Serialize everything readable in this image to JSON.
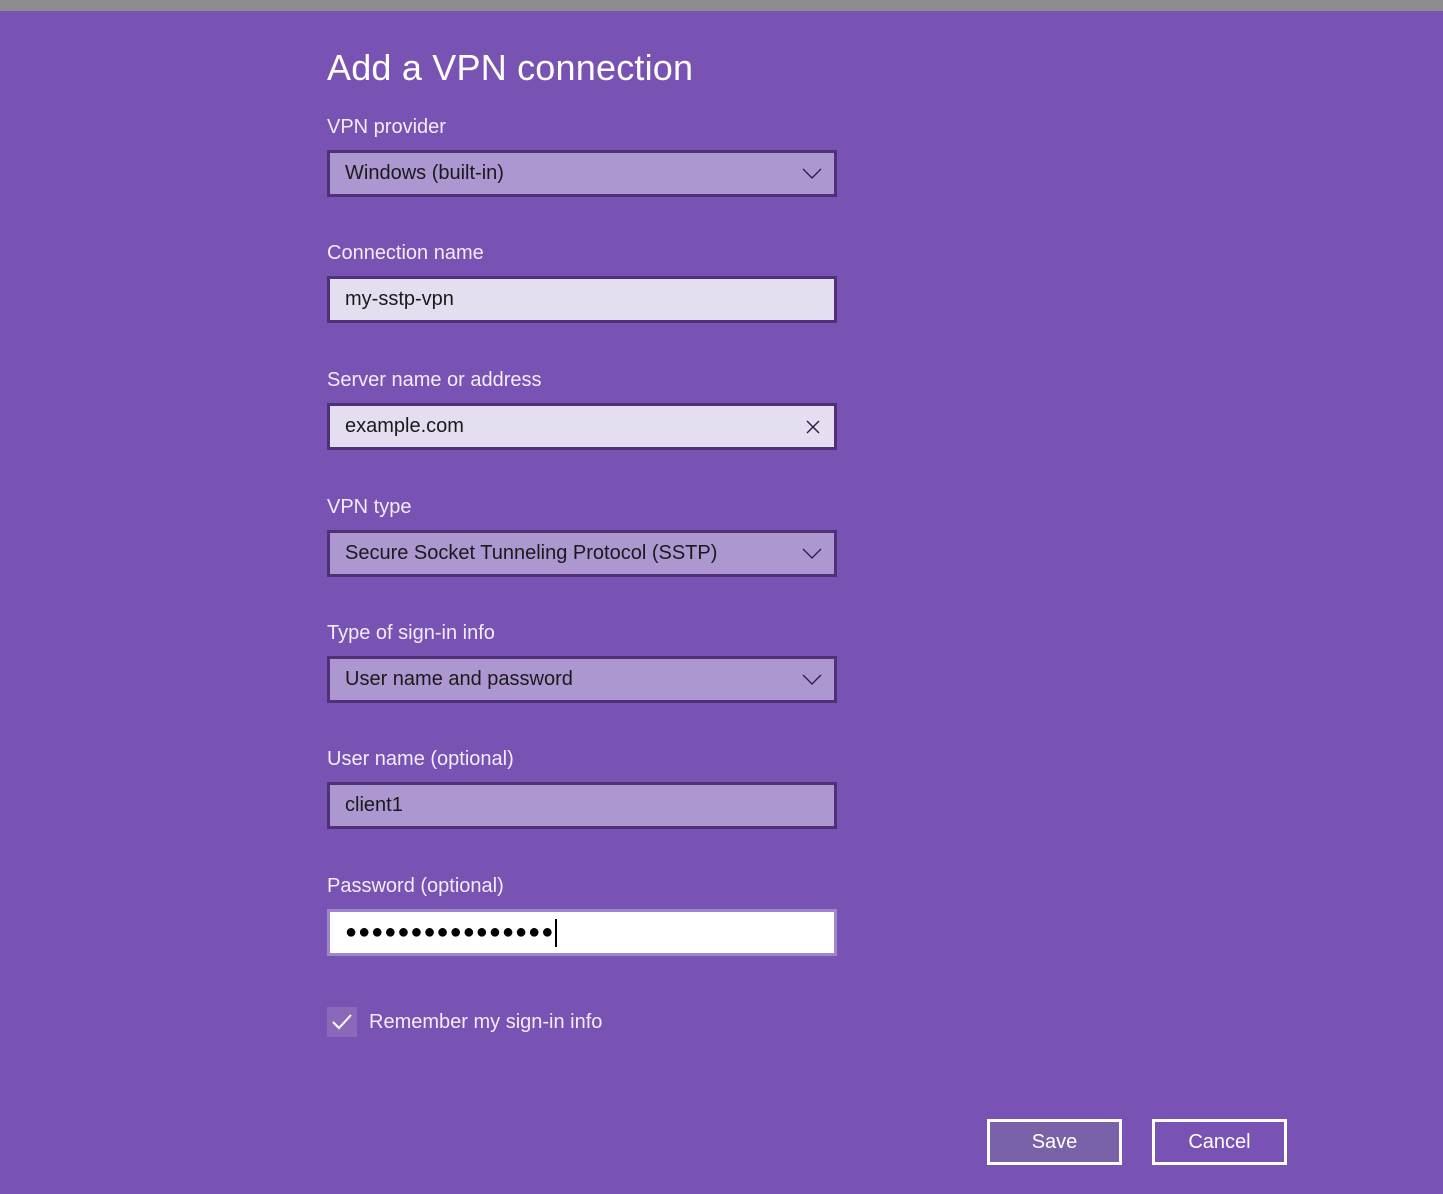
{
  "colors": {
    "background": "#7953b3",
    "top_bar": "#8c8c8c",
    "select_fill": "#ac97d1",
    "textbox_fill": "#e5ddf0",
    "control_border": "#4f3178"
  },
  "dialog": {
    "title": "Add a VPN connection",
    "fields": {
      "vpn_provider": {
        "label": "VPN provider",
        "value": "Windows (built-in)",
        "icon": "chevron-down-icon"
      },
      "connection_name": {
        "label": "Connection name",
        "value": "my-sstp-vpn"
      },
      "server_name": {
        "label": "Server name or address",
        "value": "example.com",
        "icon": "close-icon"
      },
      "vpn_type": {
        "label": "VPN type",
        "value": "Secure Socket Tunneling Protocol (SSTP)",
        "icon": "chevron-down-icon"
      },
      "sign_in_type": {
        "label": "Type of sign-in info",
        "value": "User name and password",
        "icon": "chevron-down-icon"
      },
      "user_name": {
        "label": "User name (optional)",
        "value": "client1"
      },
      "password": {
        "label": "Password (optional)",
        "masked_value": "●●●●●●●●●●●●●●●●",
        "length": 16
      }
    },
    "remember": {
      "label": "Remember my sign-in info",
      "checked": true,
      "icon": "checkmark-icon"
    },
    "buttons": {
      "save": "Save",
      "cancel": "Cancel"
    }
  }
}
